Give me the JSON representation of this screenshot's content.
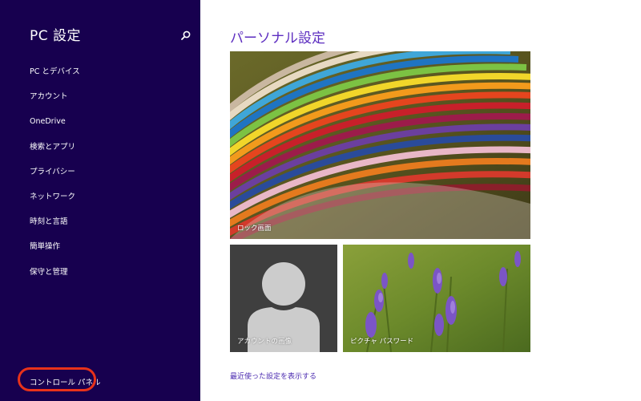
{
  "sidebar": {
    "title": "PC 設定",
    "search_icon": "search-icon",
    "items": [
      {
        "label": "PC とデバイス"
      },
      {
        "label": "アカウント"
      },
      {
        "label": "OneDrive"
      },
      {
        "label": "検索とアプリ"
      },
      {
        "label": "プライバシー"
      },
      {
        "label": "ネットワーク"
      },
      {
        "label": "時刻と言語"
      },
      {
        "label": "簡単操作"
      },
      {
        "label": "保守と管理"
      }
    ],
    "control_panel_label": "コントロール パネル",
    "bg_color": "#17004f",
    "highlight_color": "#e8321a"
  },
  "main": {
    "title": "パーソナル設定",
    "tiles": {
      "lock_screen": {
        "label": "ロック画面"
      },
      "account_picture": {
        "label": "アカウントの画像"
      },
      "picture_password": {
        "label": "ピクチャ パスワード"
      }
    },
    "recent_link": "最近使った設定を表示する",
    "accent_color": "#5d2ec0"
  }
}
